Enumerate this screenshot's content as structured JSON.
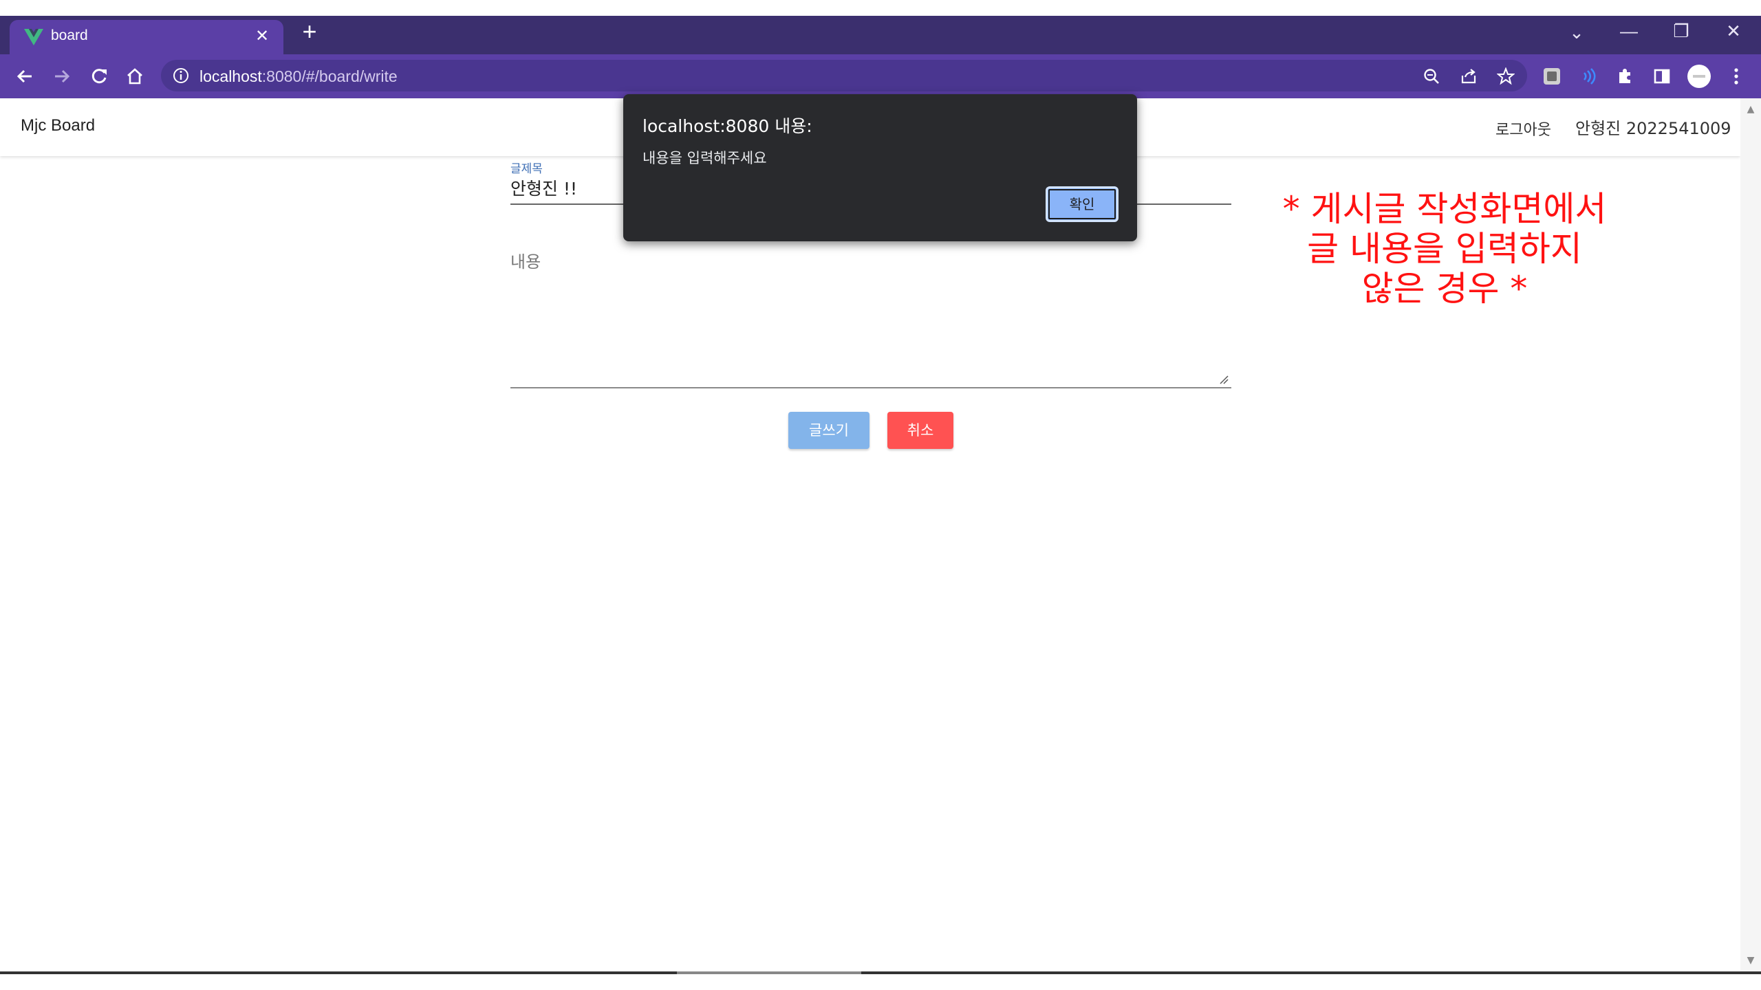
{
  "browser": {
    "tab_title": "board",
    "tab_close": "✕",
    "new_tab": "+",
    "url_host": "localhost",
    "url_path": ":8080/#/board/write",
    "window_controls": {
      "dropdown": "⌄",
      "minimize": "—",
      "restore": "❐",
      "close": "✕"
    }
  },
  "app": {
    "brand": "Mjc Board",
    "logout": "로그아웃",
    "user": "안형진 2022541009"
  },
  "form": {
    "title_label": "글제목",
    "title_value": "안형진 !!",
    "content_label": "내용",
    "write_button": "글쓰기",
    "cancel_button": "취소"
  },
  "dialog": {
    "title": "localhost:8080 내용:",
    "message": "내용을 입력해주세요",
    "ok_button": "확인"
  },
  "annotation": {
    "line1": "* 게시글 작성화면에서",
    "line2": "글 내용을 입력하지",
    "line3": "않은 경우 *"
  },
  "colors": {
    "tabstrip": "#3b2f6e",
    "toolbar": "#5b3fa6",
    "write_button": "#83b4ea",
    "cancel_button": "#ff5252",
    "annotation": "#ff1212",
    "dialog_bg": "#292a2d",
    "dialog_ok": "#8ab4f8"
  }
}
